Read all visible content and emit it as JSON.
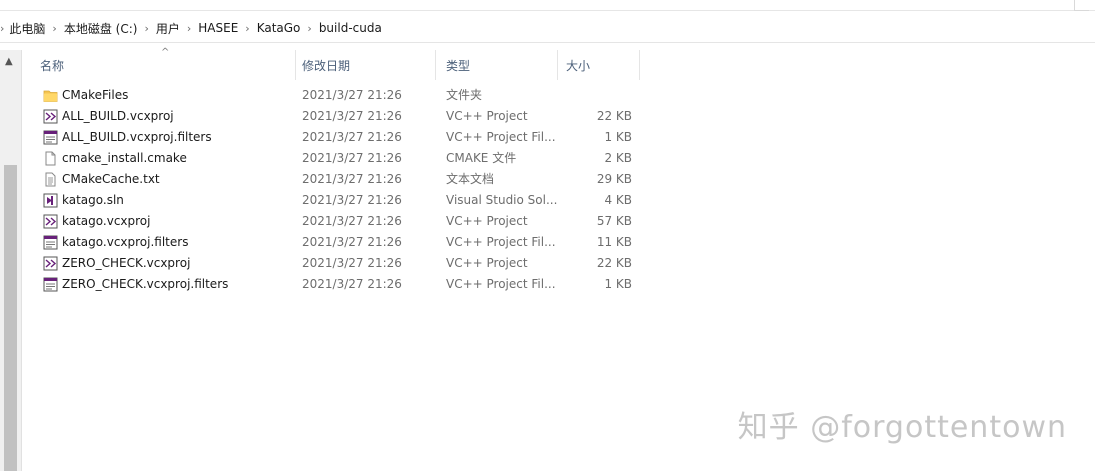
{
  "breadcrumb": [
    "此电脑",
    "本地磁盘 (C:)",
    "用户",
    "HASEE",
    "KataGo",
    "build-cuda"
  ],
  "columns": {
    "name": "名称",
    "date": "修改日期",
    "type": "类型",
    "size": "大小"
  },
  "files": [
    {
      "name": "CMakeFiles",
      "date": "2021/3/27 21:26",
      "type": "文件夹",
      "size": "",
      "icon": "folder-icon"
    },
    {
      "name": "ALL_BUILD.vcxproj",
      "date": "2021/3/27 21:26",
      "type": "VC++ Project",
      "size": "22 KB",
      "icon": "vcxproj-icon"
    },
    {
      "name": "ALL_BUILD.vcxproj.filters",
      "date": "2021/3/27 21:26",
      "type": "VC++ Project Fil...",
      "size": "1 KB",
      "icon": "filters-icon"
    },
    {
      "name": "cmake_install.cmake",
      "date": "2021/3/27 21:26",
      "type": "CMAKE 文件",
      "size": "2 KB",
      "icon": "blank-file-icon"
    },
    {
      "name": "CMakeCache.txt",
      "date": "2021/3/27 21:26",
      "type": "文本文档",
      "size": "29 KB",
      "icon": "text-file-icon"
    },
    {
      "name": "katago.sln",
      "date": "2021/3/27 21:26",
      "type": "Visual Studio Sol...",
      "size": "4 KB",
      "icon": "sln-icon"
    },
    {
      "name": "katago.vcxproj",
      "date": "2021/3/27 21:26",
      "type": "VC++ Project",
      "size": "57 KB",
      "icon": "vcxproj-icon"
    },
    {
      "name": "katago.vcxproj.filters",
      "date": "2021/3/27 21:26",
      "type": "VC++ Project Fil...",
      "size": "11 KB",
      "icon": "filters-icon"
    },
    {
      "name": "ZERO_CHECK.vcxproj",
      "date": "2021/3/27 21:26",
      "type": "VC++ Project",
      "size": "22 KB",
      "icon": "vcxproj-icon"
    },
    {
      "name": "ZERO_CHECK.vcxproj.filters",
      "date": "2021/3/27 21:26",
      "type": "VC++ Project Fil...",
      "size": "1 KB",
      "icon": "filters-icon"
    }
  ],
  "watermark": "知乎 @forgottentown",
  "colors": {
    "header_text": "#4c607a",
    "meta_text": "#6d6d6d",
    "folder": "#f5c451",
    "vs_purple": "#68217a"
  }
}
